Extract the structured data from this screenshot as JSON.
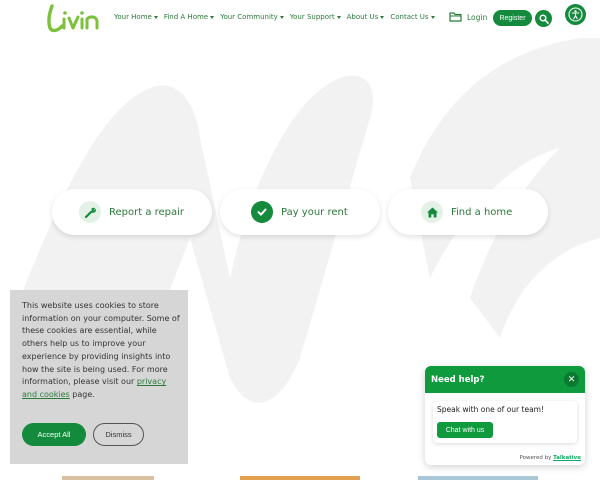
{
  "brand": {
    "logo_text": "Livin",
    "accent": "#138a3c",
    "dark_accent": "#0b7a30",
    "text_green": "#2b7a3a"
  },
  "nav": {
    "items": [
      {
        "label": "Your Home"
      },
      {
        "label": "Find A Home"
      },
      {
        "label": "Your Community"
      },
      {
        "label": "Your Support"
      },
      {
        "label": "About Us"
      },
      {
        "label": "Contact Us"
      }
    ]
  },
  "account": {
    "login_label": "Login",
    "register_label": "Register",
    "folder_icon": "folder-icon",
    "search_icon": "search-icon",
    "accessibility_icon": "accessibility-icon"
  },
  "quick_actions": [
    {
      "label": "Report a repair",
      "icon": "wrench-icon"
    },
    {
      "label": "Pay your rent",
      "icon": "checkmark-icon"
    },
    {
      "label": "Find a home",
      "icon": "home-icon"
    }
  ],
  "cookie": {
    "text": "This website uses cookies to store information on your computer. Some of these cookies are essential, while others help us to improve your experience by providing insights into how the site is being used. For more information, please visit our ",
    "link_text": "privacy and cookies",
    "text_end": " page.",
    "accept_label": "Accept All",
    "dismiss_label": "Dismiss"
  },
  "chat": {
    "title": "Need help?",
    "close_icon": "close-icon",
    "message": "Speak with one of our team!",
    "button_label": "Chat with us",
    "powered_by": "Powered by",
    "powered_brand": "Talkative"
  }
}
